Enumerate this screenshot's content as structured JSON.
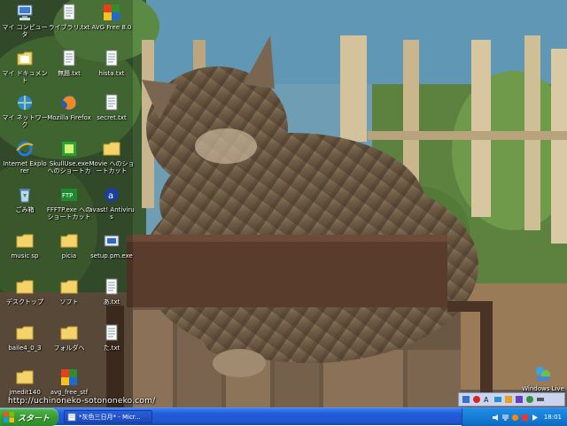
{
  "desktop": {
    "icons": [
      {
        "name": "my-computer-icon",
        "label": "マイ コンピュータ",
        "icon": "computer"
      },
      {
        "name": "library-txt-icon",
        "label": "ライブラリ.txt",
        "icon": "text-file"
      },
      {
        "name": "avg-free-icon",
        "label": "AVG Free 8.0",
        "icon": "avg"
      },
      {
        "name": "my-documents-icon",
        "label": "マイ ドキュメント",
        "icon": "documents"
      },
      {
        "name": "untitled-txt-icon",
        "label": "無題.txt",
        "icon": "text-file"
      },
      {
        "name": "hista-txt-icon",
        "label": "hista.txt",
        "icon": "text-file"
      },
      {
        "name": "my-network-icon",
        "label": "マイ ネットワーク",
        "icon": "network"
      },
      {
        "name": "mozilla-firefox-icon",
        "label": "Mozilla Firefox",
        "icon": "firefox"
      },
      {
        "name": "secret-txt-icon",
        "label": "secret.txt",
        "icon": "text-file"
      },
      {
        "name": "internet-explorer-icon",
        "label": "Internet Explorer",
        "icon": "ie"
      },
      {
        "name": "skulluse-shortcut-icon",
        "label": "SkullUse.exe へのショートカ",
        "icon": "app-green"
      },
      {
        "name": "movie-shortcut-icon",
        "label": "Movie へのショートカット",
        "icon": "folder"
      },
      {
        "name": "recycle-bin-icon",
        "label": "ごみ箱",
        "icon": "recycle"
      },
      {
        "name": "ffftp-shortcut-icon",
        "label": "FFFTP.exe へのショートカット",
        "icon": "ffftp"
      },
      {
        "name": "avast-antivirus-icon",
        "label": "avast! Antivirus",
        "icon": "avast"
      },
      {
        "name": "music-sp-folder-icon",
        "label": "music sp",
        "icon": "folder"
      },
      {
        "name": "picia-folder-icon",
        "label": "picia",
        "icon": "folder"
      },
      {
        "name": "setup-pm-exe-icon",
        "label": "setup.pm.exe",
        "icon": "setup"
      },
      {
        "name": "desktop-folder-icon",
        "label": "デスクトップ",
        "icon": "folder"
      },
      {
        "name": "soft-folder-icon",
        "label": "ソフト",
        "icon": "folder"
      },
      {
        "name": "a-txt-icon",
        "label": "あ.txt",
        "icon": "text-file"
      },
      {
        "name": "baile4-folder-icon",
        "label": "baile4_0_3",
        "icon": "folder"
      },
      {
        "name": "folder-he-icon",
        "label": "フォルダへ",
        "icon": "folder"
      },
      {
        "name": "ta-txt-icon",
        "label": "た.txt",
        "icon": "text-file"
      },
      {
        "name": "jmedit-folder-icon",
        "label": "jmedit140",
        "icon": "folder"
      },
      {
        "name": "avg-free-stf-icon",
        "label": "avg_free_stf_...",
        "icon": "installer"
      },
      {
        "name": "windows-live-icon",
        "label": "Windows Live",
        "icon": "windows-live"
      }
    ]
  },
  "overlay": {
    "site_url": "http://uchinoneko-sotononeko.com/"
  },
  "taskbar": {
    "start_label": "スタート",
    "task_window_label": "*灰色三日月* - Micr...",
    "clock": "18:01"
  },
  "colors": {
    "taskbar": "#245edb",
    "start_button": "#3a9d35",
    "systray": "#1579d1"
  }
}
